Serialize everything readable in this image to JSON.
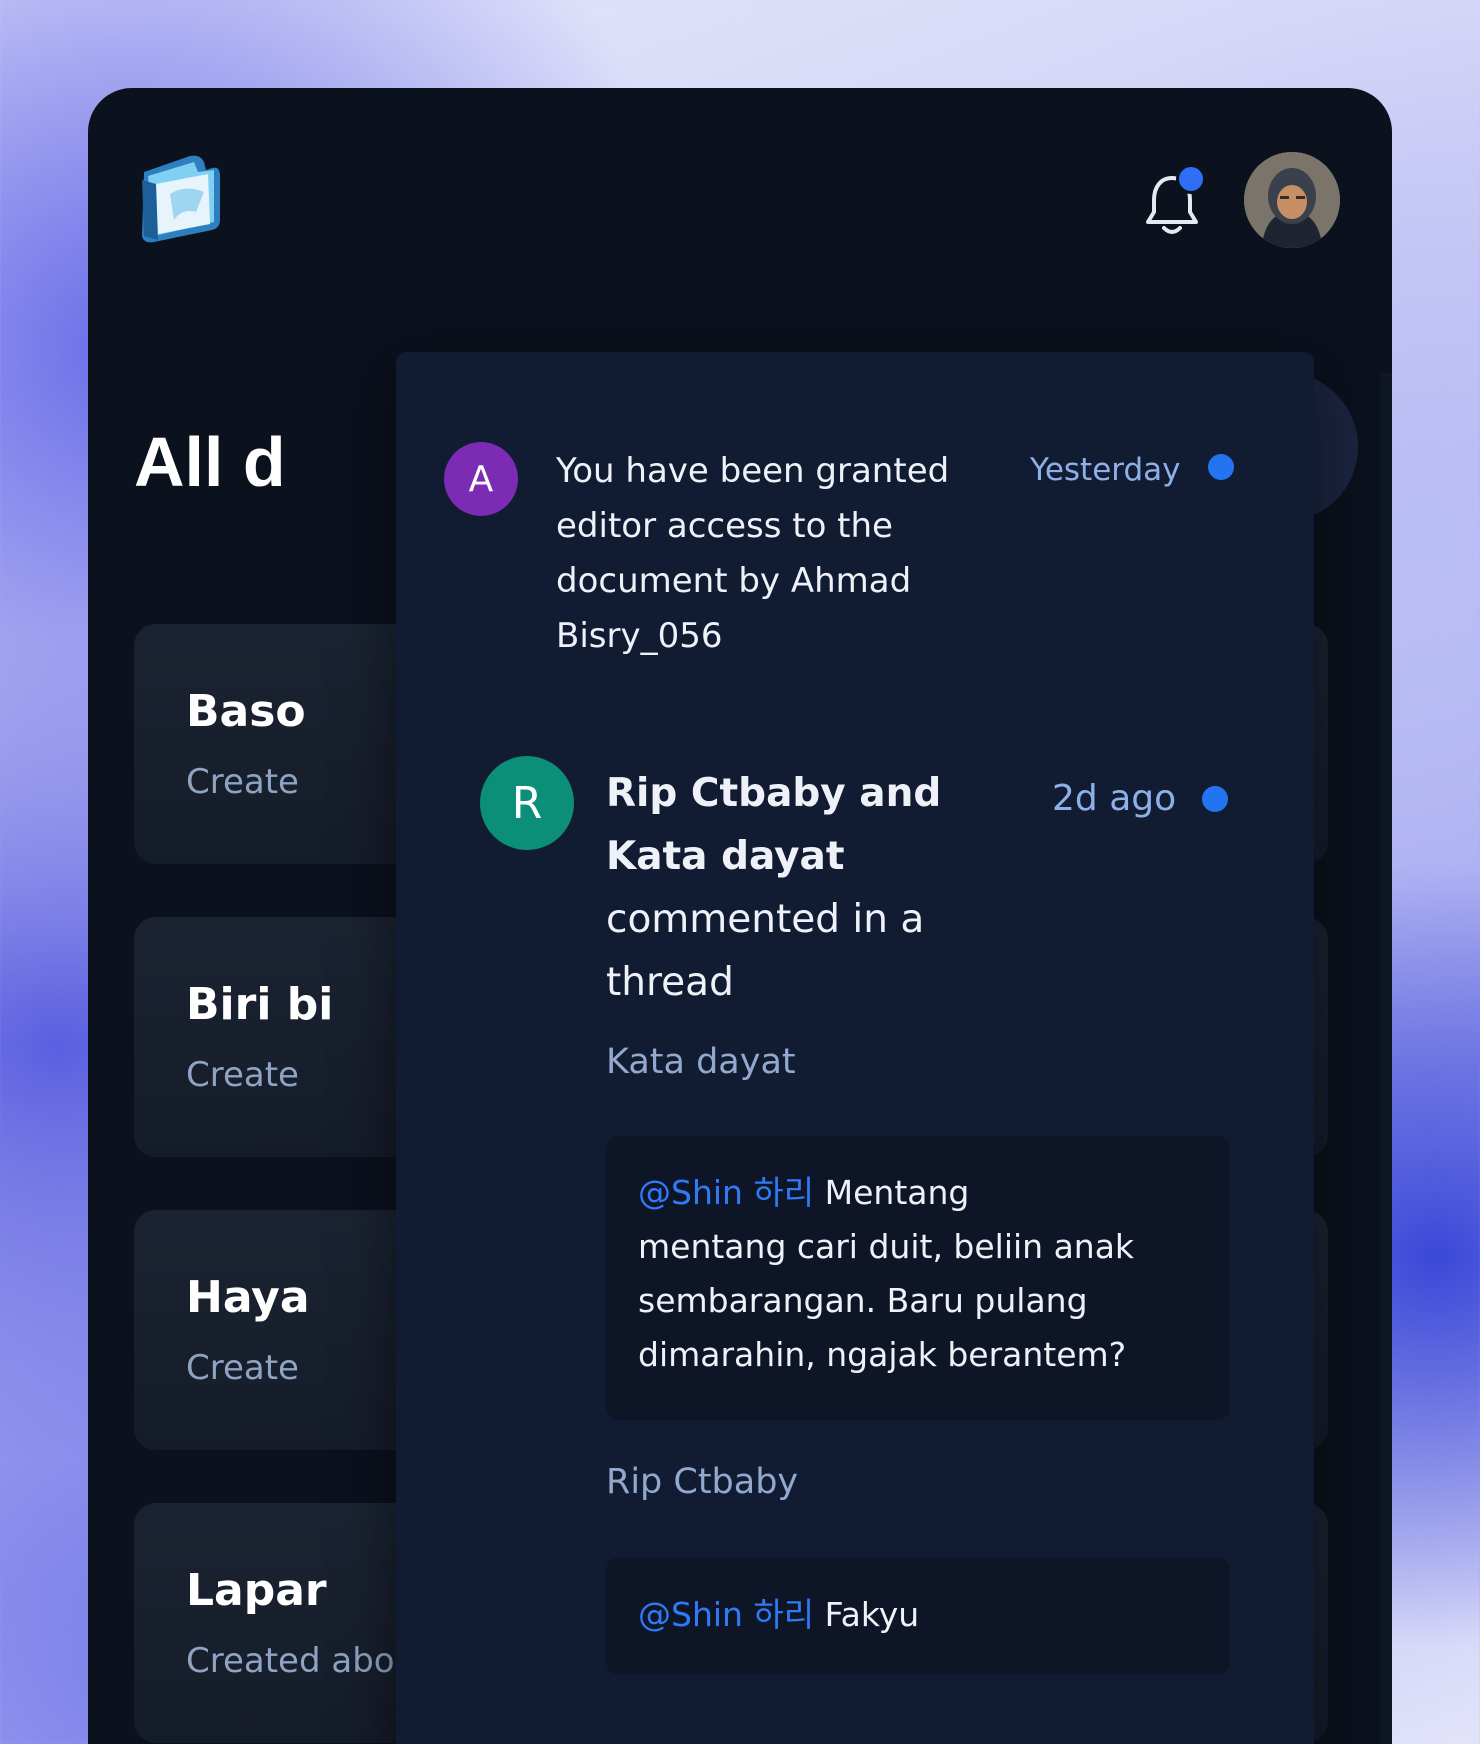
{
  "header": {
    "logo_icon": "folder-logo-icon",
    "bell_icon": "bell-icon",
    "avatar_icon": "user-avatar",
    "unread_indicator_color": "#2f6ff5"
  },
  "main": {
    "title_visible": "All d",
    "add_icon": "plus-icon",
    "cards": [
      {
        "title": "Baso",
        "meta": "Create"
      },
      {
        "title": "Biri bi",
        "meta": "Create"
      },
      {
        "title": "Haya",
        "meta": "Create"
      },
      {
        "title": "Lapar",
        "meta": "Created about 4 weeks ago"
      }
    ]
  },
  "notifications": [
    {
      "avatar_letter": "A",
      "avatar_color": "#7c2bb4",
      "message_lines": [
        "You have been granted",
        "editor access to the",
        "document by Ahmad",
        "Bisry_056"
      ],
      "time": "Yesterday",
      "unread": true
    },
    {
      "avatar_letter": "R",
      "avatar_color": "#0c8f78",
      "actors_line1": "Rip Ctbaby and",
      "actors_line2": "Kata dayat",
      "action_line1": "commented in a",
      "action_line2": "thread",
      "time": "2d ago",
      "unread": true,
      "comments": [
        {
          "author": "Kata dayat",
          "mention": "@Shin 하리",
          "text_lines": [
            " Mentang",
            "mentang cari duit, beliin anak",
            "sembarangan. Baru pulang",
            "dimarahin, ngajak berantem?"
          ]
        },
        {
          "author": "Rip Ctbaby",
          "mention": "@Shin 하리",
          "text_lines": [
            " Fakyu"
          ]
        }
      ]
    }
  ]
}
